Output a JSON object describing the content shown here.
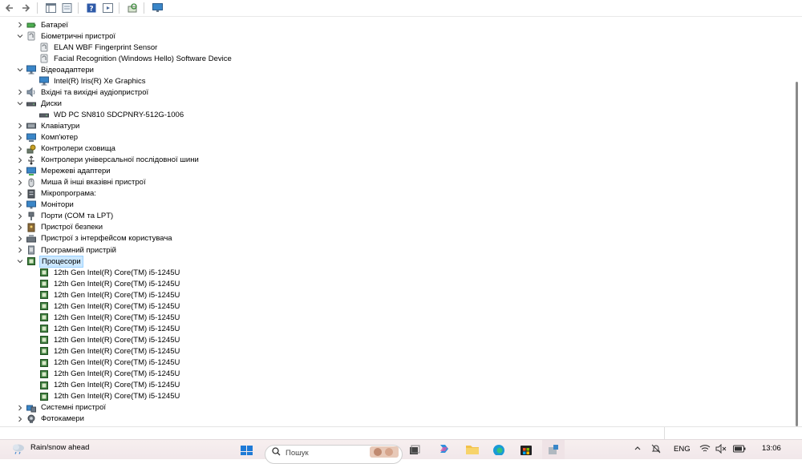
{
  "toolbar": {
    "buttons": [
      {
        "icon": "back-arrow-icon"
      },
      {
        "icon": "forward-arrow-icon"
      },
      {
        "icon": "properties-window-icon"
      },
      {
        "icon": "document-icon"
      },
      {
        "icon": "help-icon"
      },
      {
        "icon": "view-icon"
      },
      {
        "icon": "scan-hardware-icon"
      },
      {
        "icon": "monitor-icon"
      }
    ]
  },
  "tree": [
    {
      "label": "Батареї",
      "level": 0,
      "expand": "collapsed",
      "icon": "battery-icon"
    },
    {
      "label": "Біометричні пристрої",
      "level": 0,
      "expand": "expanded",
      "icon": "biometric-icon"
    },
    {
      "label": "ELAN WBF Fingerprint Sensor",
      "level": 1,
      "expand": "none",
      "icon": "biometric-icon"
    },
    {
      "label": "Facial Recognition (Windows Hello) Software Device",
      "level": 1,
      "expand": "none",
      "icon": "biometric-icon"
    },
    {
      "label": "Відеоадаптери",
      "level": 0,
      "expand": "expanded",
      "icon": "display-adapter-icon"
    },
    {
      "label": "Intel(R) Iris(R) Xe Graphics",
      "level": 1,
      "expand": "none",
      "icon": "display-adapter-icon"
    },
    {
      "label": "Вхідні та вихідні аудіопристрої",
      "level": 0,
      "expand": "collapsed",
      "icon": "speaker-icon"
    },
    {
      "label": "Диски",
      "level": 0,
      "expand": "expanded",
      "icon": "disk-drive-icon"
    },
    {
      "label": "WD PC SN810 SDCPNRY-512G-1006",
      "level": 1,
      "expand": "none",
      "icon": "disk-drive-icon"
    },
    {
      "label": "Клавіатури",
      "level": 0,
      "expand": "collapsed",
      "icon": "keyboard-icon"
    },
    {
      "label": "Комп'ютер",
      "level": 0,
      "expand": "collapsed",
      "icon": "computer-icon"
    },
    {
      "label": "Контролери сховища",
      "level": 0,
      "expand": "collapsed",
      "icon": "storage-controller-icon"
    },
    {
      "label": "Контролери універсальної послідовної шини",
      "level": 0,
      "expand": "collapsed",
      "icon": "usb-icon"
    },
    {
      "label": "Мережеві адаптери",
      "level": 0,
      "expand": "collapsed",
      "icon": "network-adapter-icon"
    },
    {
      "label": "Миша й інші вказівні пристрої",
      "level": 0,
      "expand": "collapsed",
      "icon": "mouse-icon"
    },
    {
      "label": "Мікропрограма:",
      "level": 0,
      "expand": "collapsed",
      "icon": "firmware-icon"
    },
    {
      "label": "Монітори",
      "level": 0,
      "expand": "collapsed",
      "icon": "monitor-icon"
    },
    {
      "label": "Порти (COM та LPT)",
      "level": 0,
      "expand": "collapsed",
      "icon": "port-icon"
    },
    {
      "label": "Пристрої безпеки",
      "level": 0,
      "expand": "collapsed",
      "icon": "security-device-icon"
    },
    {
      "label": "Пристрої з інтерфейсом користувача",
      "level": 0,
      "expand": "collapsed",
      "icon": "hid-icon"
    },
    {
      "label": "Програмний пристрій",
      "level": 0,
      "expand": "collapsed",
      "icon": "software-device-icon"
    },
    {
      "label": "Процесори",
      "level": 0,
      "expand": "expanded",
      "icon": "processor-icon",
      "selected": true
    },
    {
      "label": "12th Gen Intel(R) Core(TM) i5-1245U",
      "level": 1,
      "expand": "none",
      "icon": "processor-icon"
    },
    {
      "label": "12th Gen Intel(R) Core(TM) i5-1245U",
      "level": 1,
      "expand": "none",
      "icon": "processor-icon"
    },
    {
      "label": "12th Gen Intel(R) Core(TM) i5-1245U",
      "level": 1,
      "expand": "none",
      "icon": "processor-icon"
    },
    {
      "label": "12th Gen Intel(R) Core(TM) i5-1245U",
      "level": 1,
      "expand": "none",
      "icon": "processor-icon"
    },
    {
      "label": "12th Gen Intel(R) Core(TM) i5-1245U",
      "level": 1,
      "expand": "none",
      "icon": "processor-icon"
    },
    {
      "label": "12th Gen Intel(R) Core(TM) i5-1245U",
      "level": 1,
      "expand": "none",
      "icon": "processor-icon"
    },
    {
      "label": "12th Gen Intel(R) Core(TM) i5-1245U",
      "level": 1,
      "expand": "none",
      "icon": "processor-icon"
    },
    {
      "label": "12th Gen Intel(R) Core(TM) i5-1245U",
      "level": 1,
      "expand": "none",
      "icon": "processor-icon"
    },
    {
      "label": "12th Gen Intel(R) Core(TM) i5-1245U",
      "level": 1,
      "expand": "none",
      "icon": "processor-icon"
    },
    {
      "label": "12th Gen Intel(R) Core(TM) i5-1245U",
      "level": 1,
      "expand": "none",
      "icon": "processor-icon"
    },
    {
      "label": "12th Gen Intel(R) Core(TM) i5-1245U",
      "level": 1,
      "expand": "none",
      "icon": "processor-icon"
    },
    {
      "label": "12th Gen Intel(R) Core(TM) i5-1245U",
      "level": 1,
      "expand": "none",
      "icon": "processor-icon"
    },
    {
      "label": "Системні пристрої",
      "level": 0,
      "expand": "collapsed",
      "icon": "system-device-icon"
    },
    {
      "label": "Фотокамери",
      "level": 0,
      "expand": "collapsed",
      "icon": "camera-icon"
    }
  ],
  "taskbar": {
    "weather_text": "Rain/snow ahead",
    "search_placeholder": "Пошук",
    "language": "ENG",
    "time": "13:06"
  },
  "colors": {
    "selection_bg": "#cce8ff",
    "selection_border": "#99d1ff",
    "processor_green": "#3f7f3f"
  }
}
